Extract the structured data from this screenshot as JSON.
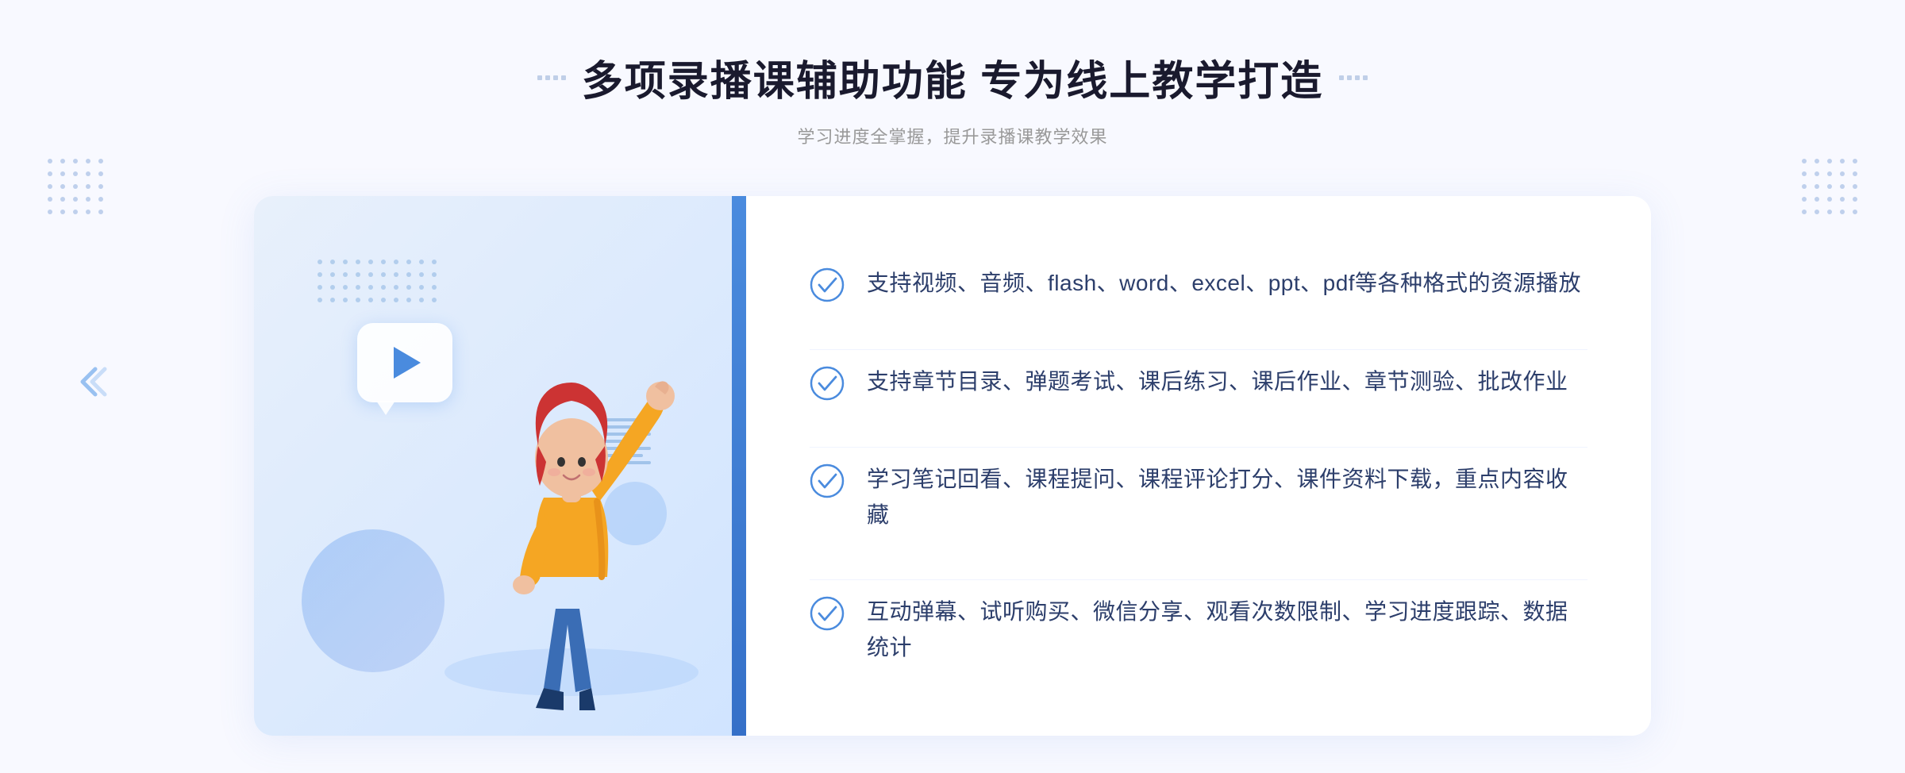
{
  "header": {
    "title": "多项录播课辅助功能 专为线上教学打造",
    "subtitle": "学习进度全掌握，提升录播课教学效果"
  },
  "features": [
    {
      "id": 1,
      "text": "支持视频、音频、flash、word、excel、ppt、pdf等各种格式的资源播放"
    },
    {
      "id": 2,
      "text": "支持章节目录、弹题考试、课后练习、课后作业、章节测验、批改作业"
    },
    {
      "id": 3,
      "text": "学习笔记回看、课程提问、课程评论打分、课件资料下载，重点内容收藏"
    },
    {
      "id": 4,
      "text": "互动弹幕、试听购买、微信分享、观看次数限制、学习进度跟踪、数据统计"
    }
  ],
  "colors": {
    "accent_blue": "#4a8bde",
    "title_color": "#1a1a2e",
    "text_color": "#2c3e6b",
    "subtitle_color": "#999999",
    "check_color": "#4a8bde"
  },
  "icons": {
    "check_circle": "check-circle-icon",
    "play": "play-icon",
    "chevron_left": "chevron-left-icon",
    "dots_deco": "dots-decoration-icon"
  }
}
